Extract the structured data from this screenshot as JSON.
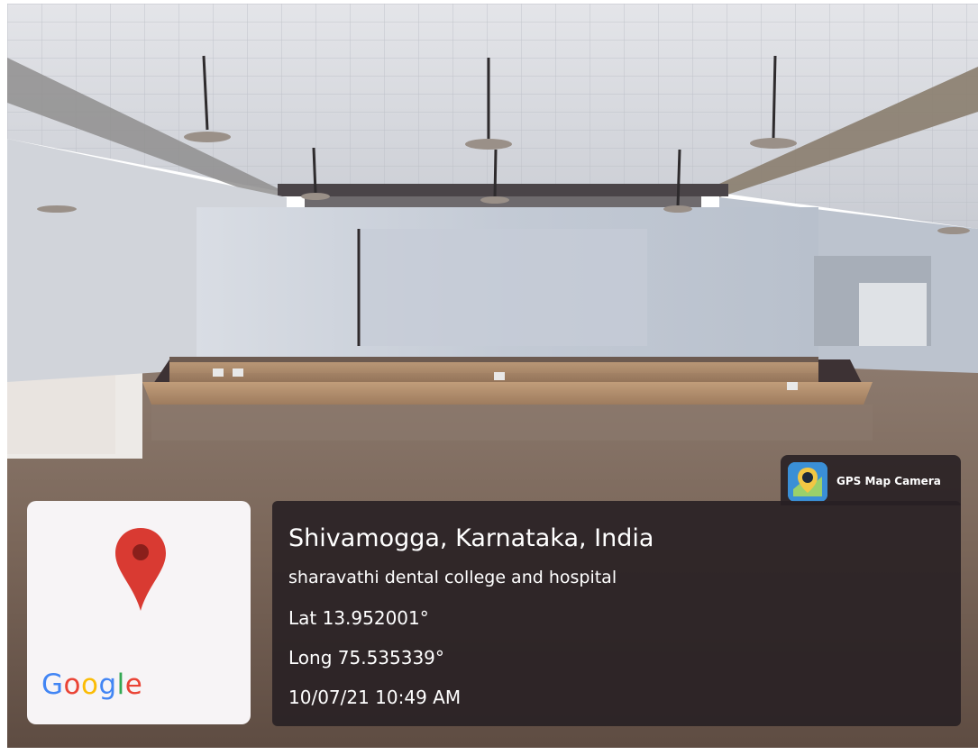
{
  "photo": {
    "scene": "auditorium-hall",
    "colors": {
      "ceiling": "#d9dbe0",
      "wall": "#c4cbd6",
      "floor": "#766456",
      "stage": "#b49474"
    }
  },
  "map_card": {
    "pin_icon": "map-pin-icon",
    "pin_color": "#d93a32",
    "logo_text": "Google",
    "logo_colors": [
      "#4285f4",
      "#ea4335",
      "#fbbc05",
      "#4285f4",
      "#34a853",
      "#ea4335"
    ]
  },
  "app": {
    "icon": "gps-map-camera-icon",
    "name": "GPS Map Camera"
  },
  "info": {
    "location": "Shivamogga, Karnataka, India",
    "place": "sharavathi dental college and hospital",
    "latitude": "Lat 13.952001°",
    "longitude": "Long 75.535339°",
    "datetime": "10/07/21 10:49 AM"
  }
}
